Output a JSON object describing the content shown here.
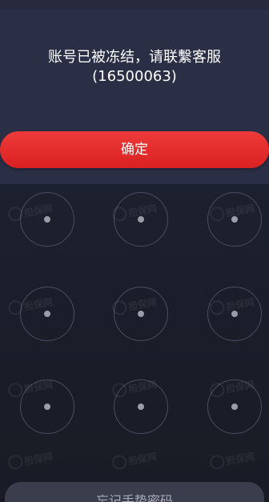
{
  "dialog": {
    "message_line1": "账号已被冻结，请联繫客服",
    "message_line2": "(16500063)",
    "confirm_label": "确定"
  },
  "pattern_lock": {
    "rows": 3,
    "cols": 3
  },
  "footer": {
    "forgot_label": "忘记手势密码"
  },
  "watermark": {
    "text": "担保网"
  },
  "colors": {
    "dialog_bg": "#2a2f46",
    "confirm_bg": "#e52c2c",
    "node_border": "#4a4e60",
    "node_dot": "#9a9ca6"
  }
}
